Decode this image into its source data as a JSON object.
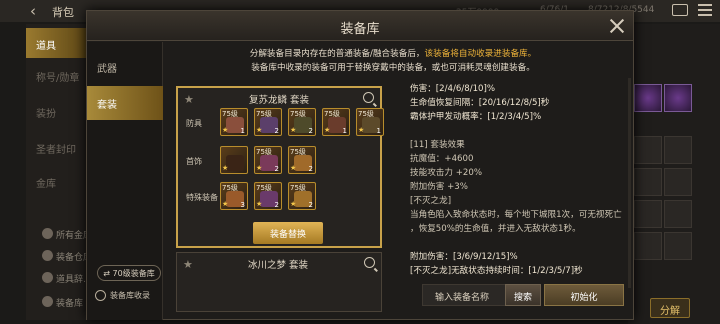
{
  "header": {
    "back_glyph": "‹",
    "title": "背包",
    "stats": [
      "25万9999",
      "6/76/1",
      "8/7212/8/5544"
    ]
  },
  "bg_sidebar": {
    "items": [
      "道具",
      "称号/勋章",
      "装扮",
      "圣者封印",
      "金库"
    ],
    "subitems": [
      "所有金库",
      "装备仓库",
      "道具辞…",
      "装备库"
    ]
  },
  "bg_right": {
    "split_label": "分解"
  },
  "modal": {
    "title": "装备库",
    "tabs": [
      "武器",
      "套装"
    ],
    "notice_line1_a": "分解装备目录内存在的普通装备/融合装备后，",
    "notice_line1_b": "该装备将自动收录进装备库。",
    "notice_line2": "装备库中收录的装备可用于替换穿戴中的装备，或也可消耗灵魂创建装备。",
    "level_toggle": "70级装备库",
    "collection_link": "装备库收录"
  },
  "sets": [
    {
      "name": "复苏龙鳞  套装",
      "rows": [
        {
          "label": "防具",
          "items": [
            {
              "lvl": "75级",
              "cnt": "1",
              "color": "#8a4f3c"
            },
            {
              "lvl": "75级",
              "cnt": "2",
              "color": "#5b3f6a"
            },
            {
              "lvl": "75级",
              "cnt": "2",
              "color": "#4e4a2a"
            },
            {
              "lvl": "75级",
              "cnt": "1",
              "color": "#6a3c2c"
            },
            {
              "lvl": "75级",
              "cnt": "1",
              "color": "#5c4a2a"
            }
          ]
        },
        {
          "label": "首饰",
          "items": [
            {
              "lvl": "",
              "cnt": "",
              "color": "#3a2416"
            },
            {
              "lvl": "75级",
              "cnt": "2",
              "color": "#7a3a5a"
            },
            {
              "lvl": "75级",
              "cnt": "2",
              "color": "#a06a2a"
            }
          ]
        },
        {
          "label": "特殊装备",
          "items": [
            {
              "lvl": "75级",
              "cnt": "3",
              "color": "#9a5a2a"
            },
            {
              "lvl": "75级",
              "cnt": "2",
              "color": "#6a3a6a"
            },
            {
              "lvl": "75级",
              "cnt": "2",
              "color": "#a0702a"
            }
          ]
        }
      ],
      "swap_label": "装备替换"
    },
    {
      "name": "冰川之梦  套装"
    }
  ],
  "detail": {
    "lines": [
      {
        "text": "伤害：[2/4/6/8/10]%",
        "bright": true
      },
      {
        "text": "生命值恢复间隔：[20/16/12/8/5]秒",
        "bright": true
      },
      {
        "text": "霸体护甲发动概率：[1/2/3/4/5]%",
        "bright": true
      },
      {
        "text": "",
        "bright": false
      },
      {
        "text": "[11] 套装效果",
        "bright": false
      },
      {
        "text": "抗魔值：+4600",
        "bright": false
      },
      {
        "text": "技能攻击力 +20%",
        "bright": false
      },
      {
        "text": "附加伤害 +3%",
        "bright": false
      },
      {
        "text": "[不灭之龙]",
        "bright": false
      },
      {
        "text": "当角色陷入致命状态时，每个地下城限1次，可无视死亡",
        "bright": false
      },
      {
        "text": "，恢复50%的生命值，并进入无敌状态1秒。",
        "bright": false
      },
      {
        "text": "",
        "bright": false
      },
      {
        "text": "附加伤害：[3/6/9/12/15]%",
        "bright": true
      },
      {
        "text": "[不灭之龙]无敌状态持续时间：[1/2/3/5/7]秒",
        "bright": true
      }
    ]
  },
  "footer": {
    "input_label": "输入装备名称",
    "search_label": "搜索",
    "init_label": "初始化"
  }
}
